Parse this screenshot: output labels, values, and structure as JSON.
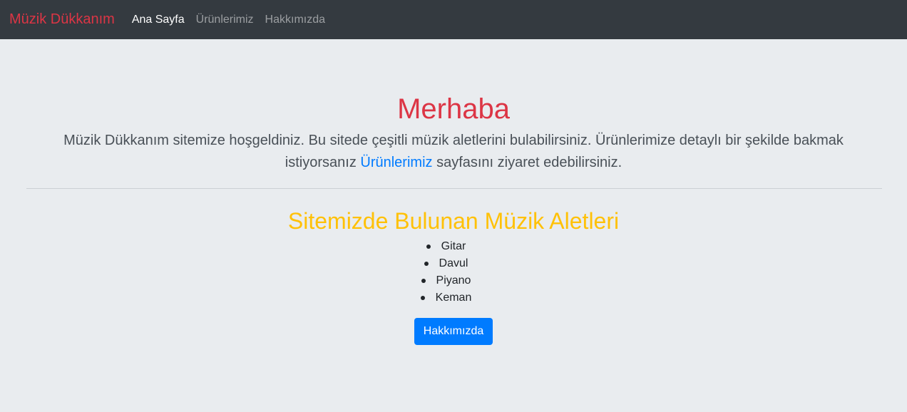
{
  "navbar": {
    "brand": "Müzik Dükkanım",
    "links": [
      {
        "label": "Ana Sayfa"
      },
      {
        "label": "Ürünlerimiz"
      },
      {
        "label": "Hakkımızda"
      }
    ]
  },
  "hero": {
    "title": "Merhaba",
    "lead_before": "Müzik Dükkanım sitemize hoşgeldiniz. Bu sitede çeşitli müzik aletlerini bulabilirsiniz. Ürünlerimize detaylı bir şekilde bakmak istiyorsanız ",
    "lead_link": "Ürünlerimiz",
    "lead_after": " sayfasını ziyaret edebilirsiniz."
  },
  "instruments": {
    "title": "Sitemizde Bulunan Müzik Aletleri",
    "items": [
      "Gitar",
      "Davul",
      "Piyano",
      "Keman"
    ],
    "button_label": "Hakkımızda"
  },
  "colors": {
    "navbar_bg": "#343a40",
    "brand": "#dc3545",
    "title": "#dc3545",
    "subtitle": "#ffc107",
    "link": "#007bff",
    "button_bg": "#007bff",
    "page_bg": "#e9ecef"
  }
}
